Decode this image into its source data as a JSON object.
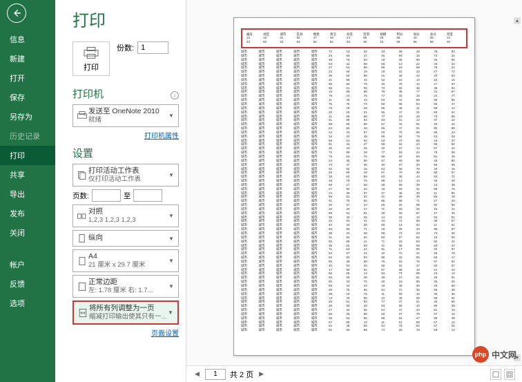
{
  "sidebar": {
    "items": [
      {
        "label": "信息",
        "active": false
      },
      {
        "label": "新建",
        "active": false
      },
      {
        "label": "打开",
        "active": false
      },
      {
        "label": "保存",
        "active": false
      },
      {
        "label": "另存为",
        "active": false
      },
      {
        "label": "历史记录",
        "active": false,
        "dim": true
      },
      {
        "label": "打印",
        "active": true
      },
      {
        "label": "共享",
        "active": false
      },
      {
        "label": "导出",
        "active": false
      },
      {
        "label": "发布",
        "active": false
      },
      {
        "label": "关闭",
        "active": false
      }
    ],
    "bottom_items": [
      {
        "label": "帐户"
      },
      {
        "label": "反馈"
      },
      {
        "label": "选项"
      }
    ]
  },
  "print": {
    "title": "打印",
    "button_label": "打印",
    "copies_label": "份数:",
    "copies_value": "1"
  },
  "printer": {
    "section_title": "打印机",
    "name": "发送至 OneNote 2010",
    "status": "就绪",
    "properties_link": "打印机属性"
  },
  "settings": {
    "section_title": "设置",
    "scope": {
      "title": "打印活动工作表",
      "sub": "仅打印活动工作表"
    },
    "pages_label": "页数:",
    "pages_to": "至",
    "collate": {
      "title": "对照",
      "sub": "1,2,3   1,2,3   1,2,3"
    },
    "orientation": {
      "title": "纵向",
      "sub": ""
    },
    "paper": {
      "title": "A4",
      "sub": "21 厘米 x 29.7 厘米"
    },
    "margins": {
      "title": "正常边距",
      "sub": "左: 1.78 厘米  右: 1.7..."
    },
    "scaling": {
      "title": "将所有列调整为一页",
      "sub": "缩减打印输出使其只有一..."
    },
    "page_setup_link": "页面设置"
  },
  "pager": {
    "current": "1",
    "total_label": "共 2 页"
  },
  "watermark": {
    "logo": "php",
    "text": "中文网"
  },
  "preview_headers": [
    "编号",
    "地区",
    "城市",
    "区县",
    "楼盘",
    "清洁",
    "标签",
    "签到",
    "规模",
    "积分",
    "加分",
    "总分",
    "月度"
  ]
}
